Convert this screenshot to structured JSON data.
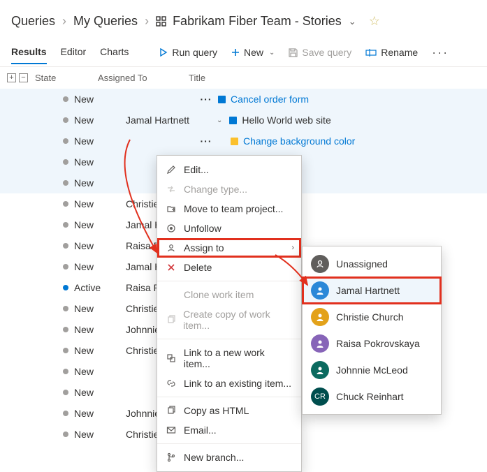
{
  "breadcrumb": {
    "root": "Queries",
    "my": "My Queries",
    "title": "Fabrikam Fiber Team - Stories"
  },
  "tabs": {
    "results": "Results",
    "editor": "Editor",
    "charts": "Charts"
  },
  "toolbar": {
    "run": "Run query",
    "new": "New",
    "save": "Save query",
    "rename": "Rename"
  },
  "headers": {
    "state": "State",
    "assigned": "Assigned To",
    "title": "Title"
  },
  "rows": [
    {
      "state": "New",
      "assigned": "",
      "title": "Cancel order form",
      "icon": "blue",
      "link": true,
      "dots": true,
      "sel": true,
      "indent": 0
    },
    {
      "state": "New",
      "assigned": "Jamal Hartnett",
      "title": "Hello World web site",
      "icon": "blue",
      "link": false,
      "chev": true,
      "sel": true,
      "indent": 0
    },
    {
      "state": "New",
      "assigned": "",
      "title": "Change background color",
      "icon": "yellow",
      "link": true,
      "dots": true,
      "sel": true,
      "indent": 1
    },
    {
      "state": "New",
      "assigned": "",
      "title": "",
      "sel": true
    },
    {
      "state": "New",
      "assigned": "",
      "title": "",
      "sel": true
    },
    {
      "state": "New",
      "assigned": "Christie Church",
      "title": ""
    },
    {
      "state": "New",
      "assigned": "Jamal Hartnett",
      "title": ""
    },
    {
      "state": "New",
      "assigned": "Raisa Pokrovskaya",
      "title": ""
    },
    {
      "state": "New",
      "assigned": "Jamal Hartnett",
      "title": ""
    },
    {
      "state": "Active",
      "assigned": "Raisa Pokrovskaya",
      "title": "",
      "active": true
    },
    {
      "state": "New",
      "assigned": "Christie Church",
      "title": ""
    },
    {
      "state": "New",
      "assigned": "Johnnie McLeod",
      "title": ""
    },
    {
      "state": "New",
      "assigned": "Christie Church",
      "title": ""
    },
    {
      "state": "New",
      "assigned": "",
      "title": ""
    },
    {
      "state": "New",
      "assigned": "",
      "title": ""
    },
    {
      "state": "New",
      "assigned": "Johnnie McLeod",
      "title": ""
    },
    {
      "state": "New",
      "assigned": "Christie Church",
      "title": ""
    }
  ],
  "ctxmenu": {
    "edit": "Edit...",
    "changetype": "Change type...",
    "move": "Move to team project...",
    "unfollow": "Unfollow",
    "assignto": "Assign to",
    "delete": "Delete",
    "clone": "Clone work item",
    "createcopy": "Create copy of work item...",
    "linknew": "Link to a new work item...",
    "linkexisting": "Link to an existing item...",
    "copyhtml": "Copy as HTML",
    "email": "Email...",
    "newbranch": "New branch..."
  },
  "submenu": {
    "unassigned": "Unassigned",
    "u1": "Jamal Hartnett",
    "u2": "Christie Church",
    "u3": "Raisa Pokrovskaya",
    "u4": "Johnnie McLeod",
    "u5": "Chuck Reinhart"
  }
}
